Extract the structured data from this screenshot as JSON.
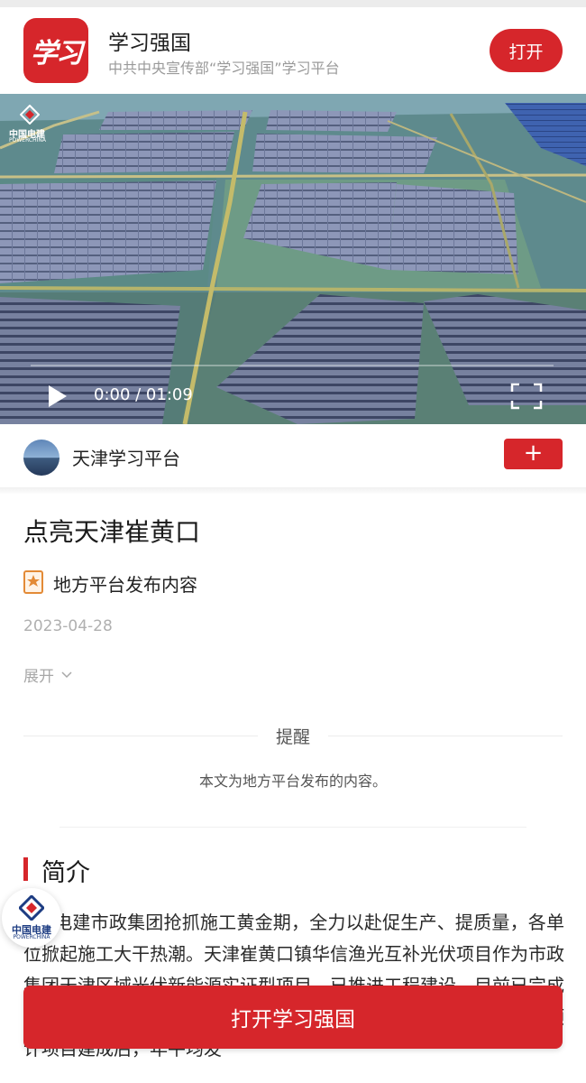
{
  "app_banner": {
    "logo_text": "学习",
    "title": "学习强国",
    "subtitle": "中共中央宣传部“学习强国”学习平台",
    "open_button": "打开"
  },
  "video": {
    "watermark_cn": "中国电建",
    "watermark_en": "POWERCHINA",
    "current_time": "0:00",
    "duration": "01:09",
    "time_display": "0:00 / 01:09",
    "progress_fraction": 0
  },
  "source": {
    "name": "天津学习平台",
    "follow_symbol": "+"
  },
  "article": {
    "title": "点亮天津崔黄口",
    "badge": "地方平台发布内容",
    "date": "2023-04-28",
    "expand": "展开"
  },
  "notice": {
    "title": "提醒",
    "body": "本文为地方平台发布的内容。"
  },
  "section": {
    "title": "简介",
    "paragraph": "电建市政集团抢抓施工黄金期，全力以赴促生产、提质量，各单位掀起施工大干热潮。天津崔黄口镇华信渔光互补光伏项目作为市政集团天津区域光伏新能源实证型项目，已推进工程建设，目前已完成光伏区桩基础、支架、13兆瓦光伏组件及升压站主要电器安装，预计项目建成后，年平均发"
  },
  "floating_logo": {
    "cn": "中国电建",
    "en": "POWERCHINA"
  },
  "bottom_cta": {
    "label": "打开学习强国"
  },
  "colors": {
    "brand_red": "#d6262b",
    "text_dark": "#222222",
    "text_muted": "#9a9a9a"
  }
}
